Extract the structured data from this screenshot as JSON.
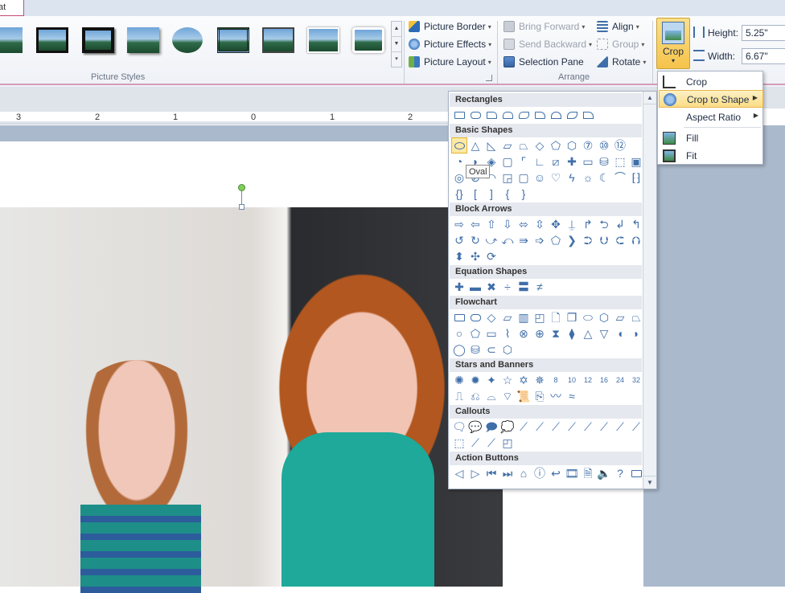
{
  "ribbon": {
    "tab_format": "at",
    "groups": {
      "picture_styles": "Picture Styles",
      "arrange": "Arrange"
    },
    "picture_commands": [
      {
        "label": "Picture Border",
        "icon": "pencil-icon"
      },
      {
        "label": "Picture Effects",
        "icon": "effects-icon"
      },
      {
        "label": "Picture Layout",
        "icon": "layout-icon"
      }
    ],
    "arrange_commands": [
      {
        "label": "Bring Forward",
        "disabled": true
      },
      {
        "label": "Send Backward",
        "disabled": true
      },
      {
        "label": "Selection Pane",
        "disabled": false
      },
      {
        "label": "Align",
        "disabled": false
      },
      {
        "label": "Group",
        "disabled": true
      },
      {
        "label": "Rotate",
        "disabled": false
      }
    ],
    "crop_label": "Crop",
    "height_label": "Height:",
    "height_value": "5.25\"",
    "width_label": "Width:",
    "width_value": "6.67\""
  },
  "ruler": {
    "ticks": [
      "3",
      "2",
      "1",
      "0",
      "1",
      "2"
    ]
  },
  "shape_panel": {
    "categories": [
      "Rectangles",
      "Basic Shapes",
      "Block Arrows",
      "Equation Shapes",
      "Flowchart",
      "Stars and Banners",
      "Callouts",
      "Action Buttons"
    ],
    "tooltip": "Oval",
    "star_badges": [
      "8",
      "10",
      "12",
      "16",
      "24",
      "32"
    ]
  },
  "crop_menu": {
    "items": [
      {
        "label": "Crop",
        "submenu": false
      },
      {
        "label": "Crop to Shape",
        "submenu": true
      },
      {
        "label": "Aspect Ratio",
        "submenu": true
      },
      {
        "label": "Fill",
        "submenu": false
      },
      {
        "label": "Fit",
        "submenu": false
      }
    ]
  },
  "colors": {
    "accent_pink": "#c84d7c",
    "highlight_gold": "#f5c34b",
    "shape_blue": "#3f6ea8"
  }
}
